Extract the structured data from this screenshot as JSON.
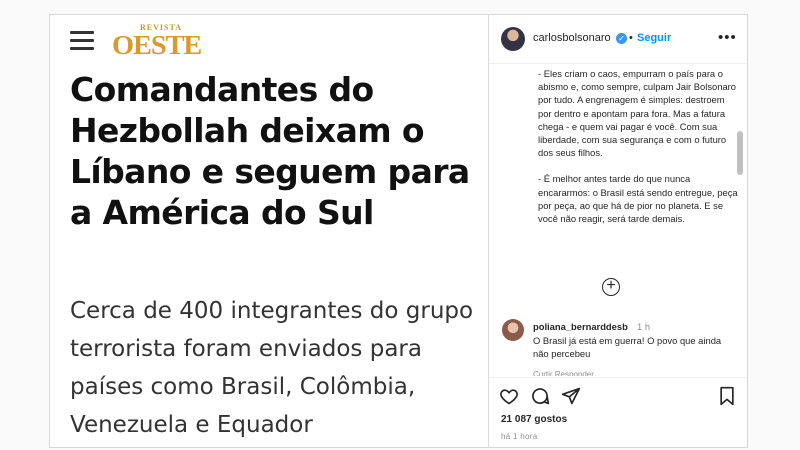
{
  "article": {
    "logo_small": "REVISTA",
    "logo_big": "OESTE",
    "headline": "Comandantes do Hezbollah deixam o Líbano e seguem para a América do Sul",
    "subheadline": "Cerca de 400 integrantes do grupo terrorista foram enviados para países como Brasil, Colômbia, Venezuela e Equador"
  },
  "post": {
    "username": "carlosbolsonaro",
    "separator": "•",
    "follow_label": "Seguir",
    "more_label": "•••",
    "caption": [
      "- Eles criam o caos, empurram o país para o abismo e, como sempre, culpam Jair Bolsonaro por tudo. A engrenagem é simples: destroem por dentro e apontam para fora. Mas a fatura chega - e quem vai pagar é você. Com sua liberdade, com sua segurança e com o futuro dos seus filhos.",
      "- É melhor antes tarde do que nunca encararmos: o Brasil está sendo entregue, peça por peça, ao que há de pior no planeta. E se você não reagir, será tarde demais."
    ],
    "load_more": "+",
    "comment": {
      "user": "poliana_bernarddesb",
      "time": "1 h",
      "text": "O Brasil já está em guerra! O povo que ainda não percebeu",
      "reply": "Curtir     Responder"
    },
    "likes": "21 087 gostos",
    "timestamp": "há 1 hora"
  },
  "colors": {
    "accent": "#0095f6",
    "logo": "#d89a2c",
    "verified": "#3897f0"
  },
  "icons": [
    "hamburger-icon",
    "verified-icon",
    "more-icon",
    "add-comment-icon",
    "heart-icon",
    "comment-icon",
    "share-icon",
    "bookmark-icon"
  ]
}
